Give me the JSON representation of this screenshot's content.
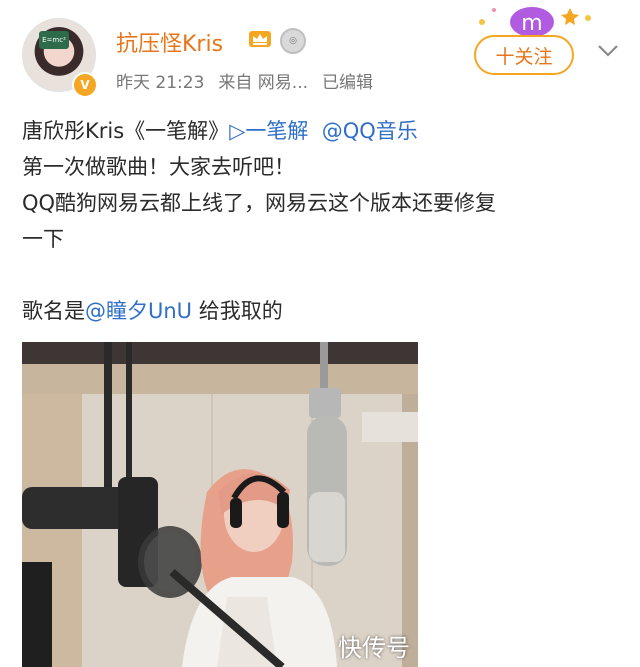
{
  "user": {
    "name": "抗压怪Kris",
    "verified_badge": "V",
    "avatar_text": "E=mc²"
  },
  "meta": {
    "time": "昨天 21:23",
    "source": "来自 网易...",
    "edited": "已编辑"
  },
  "follow_label": "十关注",
  "deco_letter": "m",
  "post": {
    "line1_prefix": "唐欣彤Kris《一笔解》",
    "line1_music_link": "▷一笔解",
    "line1_mention": "@QQ音乐",
    "line2": "第一次做歌曲！大家去听吧！",
    "line3": "QQ酷狗网易云都上线了，网易云这个版本还要修复",
    "line4": "一下",
    "line5_prefix": "歌名是",
    "line5_mention": "@瞳夕UnU",
    "line5_suffix": " 给我取的"
  },
  "watermark": "快传号",
  "colors": {
    "username": "#e8751a",
    "link": "#2f6fc9",
    "follow_border": "#f5a623"
  },
  "icons": [
    "crown-icon",
    "medal-icon",
    "chevron-down-icon",
    "play-icon"
  ]
}
